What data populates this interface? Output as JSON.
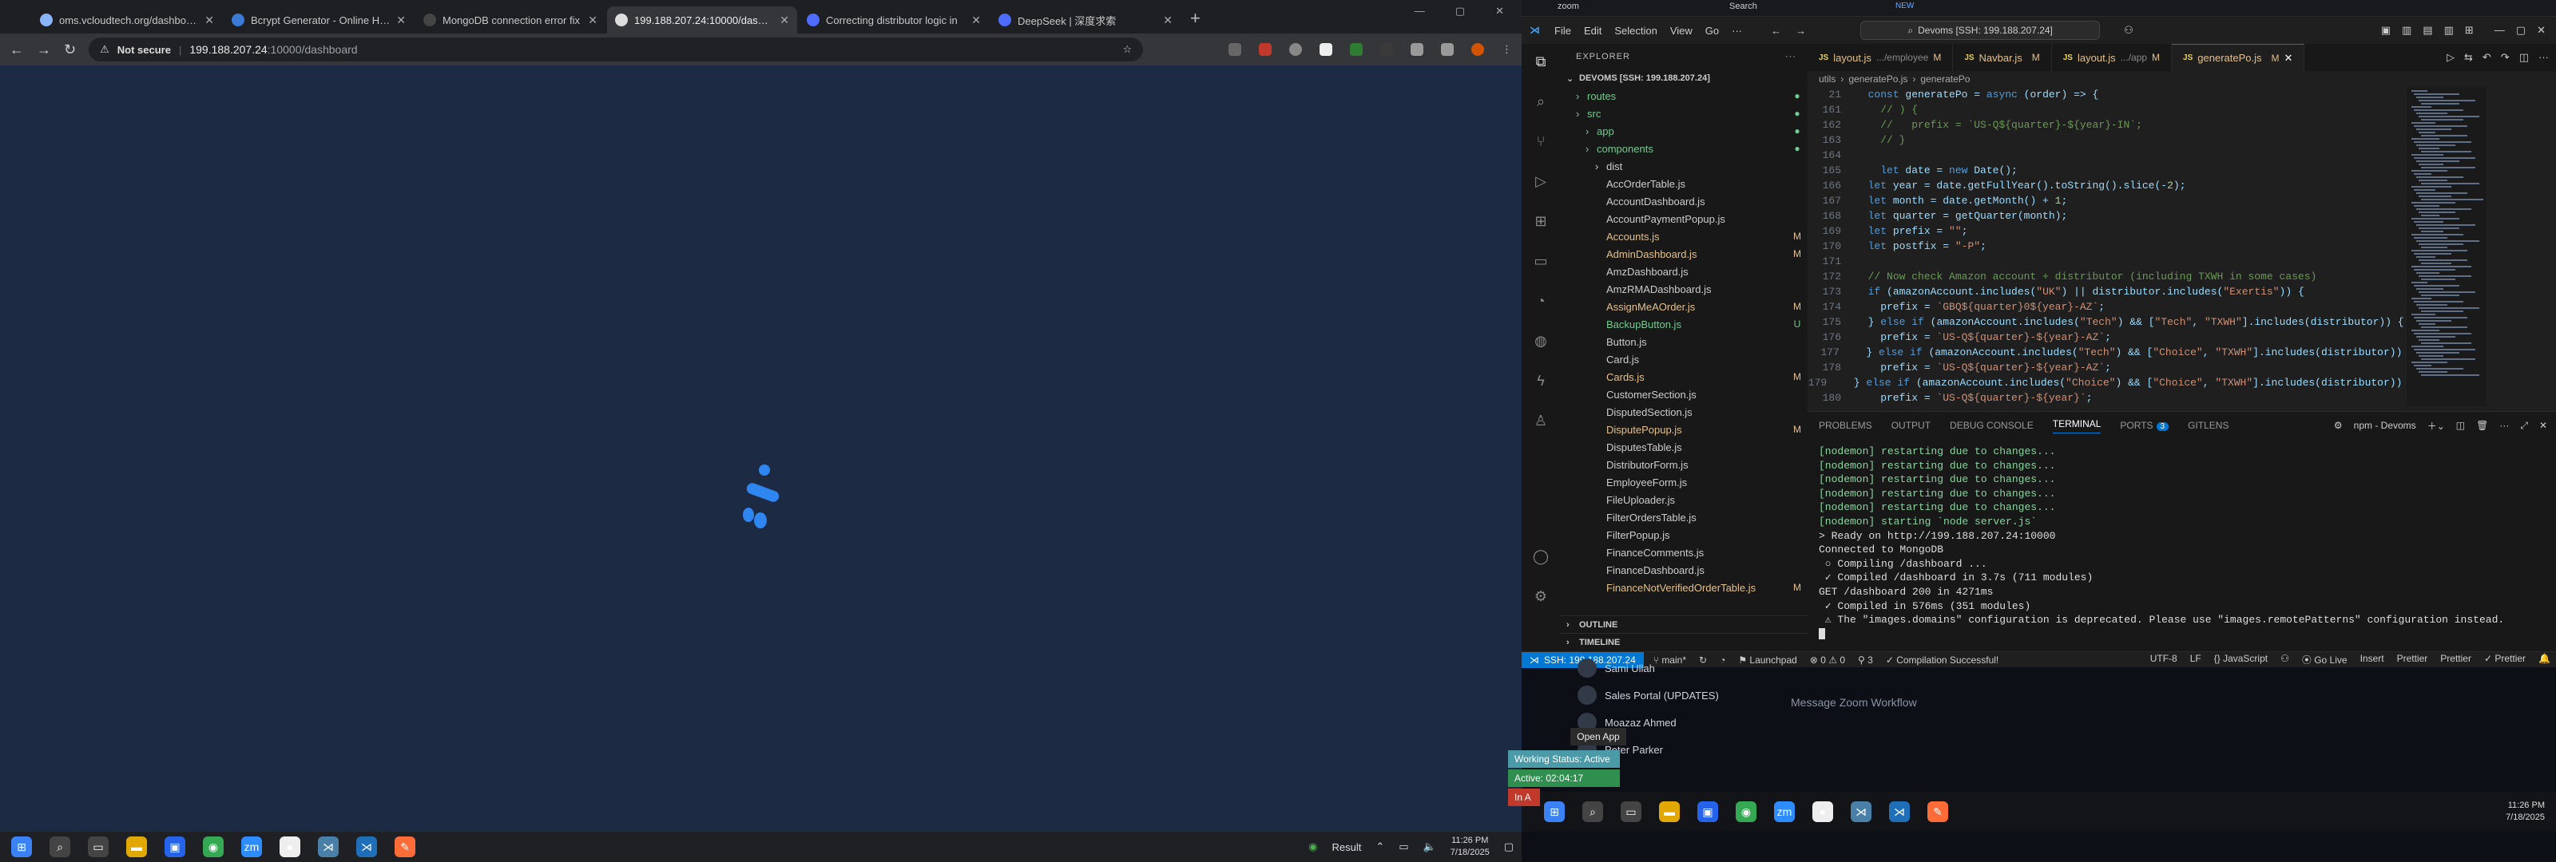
{
  "browser": {
    "tabs": [
      {
        "title": "oms.vcloudtech.org/dashboard",
        "favicon_color": "#8ab4f8"
      },
      {
        "title": "Bcrypt Generator - Online Has",
        "favicon_color": "#3a7bd5"
      },
      {
        "title": "MongoDB connection error fix",
        "favicon_color": "#444444"
      },
      {
        "title": "199.188.207.24:10000/dashboa",
        "favicon_color": "#dddddd"
      },
      {
        "title": "Correcting distributor logic in",
        "favicon_color": "#4d6bfe"
      },
      {
        "title": "DeepSeek | 深度求索",
        "favicon_color": "#4d6bfe"
      }
    ],
    "active_tab_index": 3,
    "security_label": "Not secure",
    "url_host": "199.188.207.24",
    "url_path": ":10000/dashboard",
    "page_background": "#1c2a44",
    "spinner_color": "#2f86f0"
  },
  "taskbar1": {
    "icons": [
      "start-icon",
      "search-icon",
      "taskview-icon",
      "file-explorer-icon",
      "store-icon",
      "chrome-icon",
      "zoom-icon",
      "app-icon",
      "vscode-icon",
      "vscode-active-icon",
      "postman-icon"
    ],
    "weather_label": "Result",
    "time": "11:26 PM",
    "date": "7/18/2025"
  },
  "overlay": {
    "open_app": "Open App",
    "working_status": "Working Status: Active",
    "active_time": "Active: 02:04:17",
    "in_label": "In A",
    "working_color": "#4a9aa8",
    "active_color": "#2f8f4f",
    "in_color": "#c0392b"
  },
  "vscode": {
    "menu": [
      "File",
      "Edit",
      "Selection",
      "View",
      "Go",
      "···"
    ],
    "search": "Devoms [SSH: 199.188.207.24]",
    "explorer_title": "EXPLORER",
    "root": "DEVOMS [SSH: 199.188.207.24]",
    "tree": [
      {
        "name": "routes",
        "indent": 1,
        "kind": "folder",
        "badge": "●",
        "color": "#73c991"
      },
      {
        "name": "src",
        "indent": 1,
        "kind": "folder",
        "badge": "●",
        "color": "#73c991"
      },
      {
        "name": "app",
        "indent": 2,
        "kind": "folder",
        "badge": "●",
        "color": "#73c991"
      },
      {
        "name": "components",
        "indent": 2,
        "kind": "folder",
        "badge": "●",
        "color": "#73c991"
      },
      {
        "name": "dist",
        "indent": 3,
        "kind": "folder",
        "badge": "",
        "color": "#cccccc"
      },
      {
        "name": "AccOrderTable.js",
        "indent": 3,
        "kind": "file",
        "badge": "",
        "color": "#cccccc"
      },
      {
        "name": "AccountDashboard.js",
        "indent": 3,
        "kind": "file",
        "badge": "",
        "color": "#cccccc"
      },
      {
        "name": "AccountPaymentPopup.js",
        "indent": 3,
        "kind": "file",
        "badge": "",
        "color": "#cccccc"
      },
      {
        "name": "Accounts.js",
        "indent": 3,
        "kind": "file",
        "badge": "M",
        "color": "#e2c08d"
      },
      {
        "name": "AdminDashboard.js",
        "indent": 3,
        "kind": "file",
        "badge": "M",
        "color": "#e2c08d"
      },
      {
        "name": "AmzDashboard.js",
        "indent": 3,
        "kind": "file",
        "badge": "",
        "color": "#cccccc"
      },
      {
        "name": "AmzRMADashboard.js",
        "indent": 3,
        "kind": "file",
        "badge": "",
        "color": "#cccccc"
      },
      {
        "name": "AssignMeAOrder.js",
        "indent": 3,
        "kind": "file",
        "badge": "M",
        "color": "#e2c08d"
      },
      {
        "name": "BackupButton.js",
        "indent": 3,
        "kind": "file",
        "badge": "U",
        "color": "#73c991"
      },
      {
        "name": "Button.js",
        "indent": 3,
        "kind": "file",
        "badge": "",
        "color": "#cccccc"
      },
      {
        "name": "Card.js",
        "indent": 3,
        "kind": "file",
        "badge": "",
        "color": "#cccccc"
      },
      {
        "name": "Cards.js",
        "indent": 3,
        "kind": "file",
        "badge": "M",
        "color": "#e2c08d"
      },
      {
        "name": "CustomerSection.js",
        "indent": 3,
        "kind": "file",
        "badge": "",
        "color": "#cccccc"
      },
      {
        "name": "DisputedSection.js",
        "indent": 3,
        "kind": "file",
        "badge": "",
        "color": "#cccccc"
      },
      {
        "name": "DisputePopup.js",
        "indent": 3,
        "kind": "file",
        "badge": "M",
        "color": "#e2c08d"
      },
      {
        "name": "DisputesTable.js",
        "indent": 3,
        "kind": "file",
        "badge": "",
        "color": "#cccccc"
      },
      {
        "name": "DistributorForm.js",
        "indent": 3,
        "kind": "file",
        "badge": "",
        "color": "#cccccc"
      },
      {
        "name": "EmployeeForm.js",
        "indent": 3,
        "kind": "file",
        "badge": "",
        "color": "#cccccc"
      },
      {
        "name": "FileUploader.js",
        "indent": 3,
        "kind": "file",
        "badge": "",
        "color": "#cccccc"
      },
      {
        "name": "FilterOrdersTable.js",
        "indent": 3,
        "kind": "file",
        "badge": "",
        "color": "#cccccc"
      },
      {
        "name": "FilterPopup.js",
        "indent": 3,
        "kind": "file",
        "badge": "",
        "color": "#cccccc"
      },
      {
        "name": "FinanceComments.js",
        "indent": 3,
        "kind": "file",
        "badge": "",
        "color": "#cccccc"
      },
      {
        "name": "FinanceDashboard.js",
        "indent": 3,
        "kind": "file",
        "badge": "",
        "color": "#cccccc"
      },
      {
        "name": "FinanceNotVerifiedOrderTable.js",
        "indent": 3,
        "kind": "file",
        "badge": "M",
        "color": "#e2c08d"
      }
    ],
    "outline": "OUTLINE",
    "timeline": "TIMELINE",
    "editor_tabs": [
      {
        "name": "layout.js",
        "hint": ".../employee",
        "badge": "M"
      },
      {
        "name": "Navbar.js",
        "hint": "",
        "badge": "M"
      },
      {
        "name": "layout.js",
        "hint": ".../app",
        "badge": "M"
      },
      {
        "name": "generatePo.js",
        "hint": "",
        "badge": "M"
      }
    ],
    "active_editor_tab": 3,
    "breadcrumb": [
      "utils",
      "generatePo.js",
      "generatePo"
    ],
    "code_lines": [
      {
        "n": "21",
        "t": "  const generatePo = async (order) => {"
      },
      {
        "n": "161",
        "t": "    // ) {"
      },
      {
        "n": "162",
        "t": "    //   prefix = `US-Q${quarter}-${year}-IN`;"
      },
      {
        "n": "163",
        "t": "    // }"
      },
      {
        "n": "164",
        "t": ""
      },
      {
        "n": "165",
        "t": "    let date = new Date();"
      },
      {
        "n": "166",
        "t": "  let year = date.getFullYear().toString().slice(-2);"
      },
      {
        "n": "167",
        "t": "  let month = date.getMonth() + 1;"
      },
      {
        "n": "168",
        "t": "  let quarter = getQuarter(month);"
      },
      {
        "n": "169",
        "t": "  let prefix = \"\";"
      },
      {
        "n": "170",
        "t": "  let postfix = \"-P\";"
      },
      {
        "n": "171",
        "t": ""
      },
      {
        "n": "172",
        "t": "  // Now check Amazon account + distributor (including TXWH in some cases)"
      },
      {
        "n": "173",
        "t": "  if (amazonAccount.includes(\"UK\") || distributor.includes(\"Exertis\")) {"
      },
      {
        "n": "174",
        "t": "    prefix = `GBQ${quarter}0${year}-AZ`;"
      },
      {
        "n": "175",
        "t": "  } else if (amazonAccount.includes(\"Tech\") && [\"Tech\", \"TXWH\"].includes(distributor)) {"
      },
      {
        "n": "176",
        "t": "    prefix = `US-Q${quarter}-${year}-AZ`;"
      },
      {
        "n": "177",
        "t": "  } else if (amazonAccount.includes(\"Tech\") && [\"Choice\", \"TXWH\"].includes(distributor)) {"
      },
      {
        "n": "178",
        "t": "    prefix = `US-Q${quarter}-${year}-AZ`;"
      },
      {
        "n": "179",
        "t": "  } else if (amazonAccount.includes(\"Choice\") && [\"Choice\", \"TXWH\"].includes(distributor)) {"
      },
      {
        "n": "180",
        "t": "    prefix = `US-Q${quarter}-${year}`;"
      }
    ],
    "panel_tabs": [
      "PROBLEMS",
      "OUTPUT",
      "DEBUG CONSOLE",
      "TERMINAL",
      "PORTS",
      "GITLENS"
    ],
    "active_panel_tab": 3,
    "ports_count": "3",
    "terminal_name": "npm - Devoms",
    "terminal_lines": [
      {
        "t": "[nodemon] restarting due to changes...",
        "color": "#8bd3a0"
      },
      {
        "t": "[nodemon] restarting due to changes...",
        "color": "#8bd3a0"
      },
      {
        "t": "[nodemon] restarting due to changes...",
        "color": "#8bd3a0"
      },
      {
        "t": "[nodemon] restarting due to changes...",
        "color": "#8bd3a0"
      },
      {
        "t": "[nodemon] restarting due to changes...",
        "color": "#8bd3a0"
      },
      {
        "t": "[nodemon] starting `node server.js`",
        "color": "#8bd3a0"
      },
      {
        "t": "> Ready on http://199.188.207.24:10000",
        "color": "#dddddd"
      },
      {
        "t": "Connected to MongoDB",
        "color": "#dddddd"
      },
      {
        "t": " ○ Compiling /dashboard ...",
        "color": "#dddddd"
      },
      {
        "t": " ✓ Compiled /dashboard in 3.7s (711 modules)",
        "color": "#dddddd"
      },
      {
        "t": "GET /dashboard 200 in 4271ms",
        "color": "#dddddd"
      },
      {
        "t": " ✓ Compiled in 576ms (351 modules)",
        "color": "#dddddd"
      },
      {
        "t": " ⚠ The \"images.domains\" configuration is deprecated. Please use \"images.remotePatterns\" configuration instead.",
        "color": "#dddddd"
      }
    ],
    "status": {
      "remote": "SSH: 199.188.207.24",
      "branch": "main*",
      "launchpad": "Launchpad",
      "errors": "0",
      "warnings": "0",
      "ports": "3",
      "compile": "Compilation Successful!",
      "encoding": "UTF-8",
      "eol": "LF",
      "language": "JavaScript",
      "golive": "Go Live",
      "insert": "Insert",
      "prettier1": "Prettier",
      "prettier2": "Prettier",
      "prettier3": "Prettier"
    }
  },
  "zoom": {
    "chats": [
      {
        "name": "Sami Ullah"
      },
      {
        "name": "Sales Portal (UPDATES)"
      },
      {
        "name": "Moazaz Ahmed"
      },
      {
        "name": "Peter Parker"
      }
    ],
    "compose_placeholder": "Message Zoom Workflow",
    "top_label": "zoom",
    "search_label": "Search",
    "new_badge": "NEW"
  },
  "taskbar2": {
    "icons": [
      "start-icon",
      "search-icon",
      "taskview-icon",
      "file-explorer-icon",
      "store-icon",
      "chrome-icon",
      "zoom-icon",
      "app-icon",
      "vscode-icon",
      "vscode-active-icon",
      "postman-icon"
    ],
    "time": "11:26 PM",
    "date": "7/18/2025"
  }
}
